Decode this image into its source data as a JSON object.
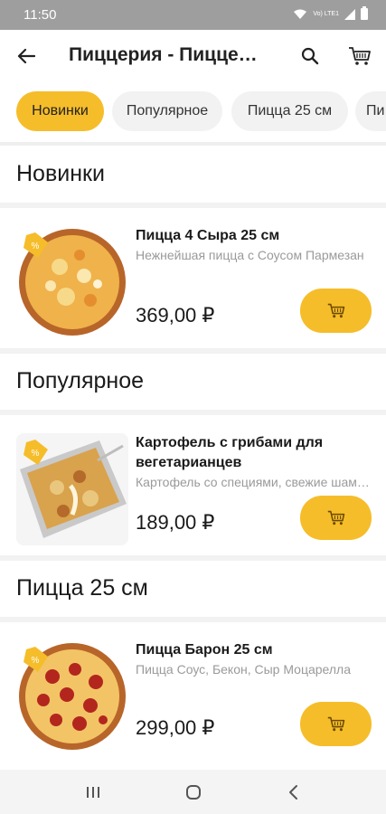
{
  "status_bar": {
    "time": "11:50",
    "network_label": "Vo) LTE1",
    "icons": [
      "wifi-icon",
      "signal-icon",
      "battery-icon"
    ]
  },
  "toolbar": {
    "title": "Пиццерия - Пиццерия",
    "back_icon": "arrow-left-icon",
    "search_icon": "search-icon",
    "cart_icon": "cart-icon"
  },
  "chips": [
    {
      "label": "Новинки",
      "active": true
    },
    {
      "label": "Популярное",
      "active": false
    },
    {
      "label": "Пицца 25 см",
      "active": false
    },
    {
      "label": "Пи",
      "active": false
    }
  ],
  "sections": [
    {
      "title": "Новинки",
      "product": {
        "name": "Пицца  4 Сыра 25 см",
        "description": "Нежнейшая пицца с Соусом  Пармезан",
        "price": "369,00 ₽",
        "image": "four-cheese-pizza"
      }
    },
    {
      "title": "Популярное",
      "product": {
        "name": "Картофель с грибами для вегетарианцев",
        "description": "Картофель со специями, свежие шампиньоны",
        "price": "189,00 ₽",
        "image": "potato-mushroom-bake"
      }
    },
    {
      "title": "Пицца 25 см",
      "product": {
        "name": "Пицца Барон 25 см",
        "description": "Пицца Соус, Бекон, Сыр Моцарелла",
        "price": "299,00 ₽",
        "image": "pepperoni-pizza"
      }
    }
  ],
  "colors": {
    "accent": "#f6bd2a",
    "status_bar": "#9e9e9e",
    "description_text": "#9a9a9a"
  },
  "nav_bar": {
    "icons": [
      "recent-apps-icon",
      "home-icon",
      "back-nav-icon"
    ]
  }
}
